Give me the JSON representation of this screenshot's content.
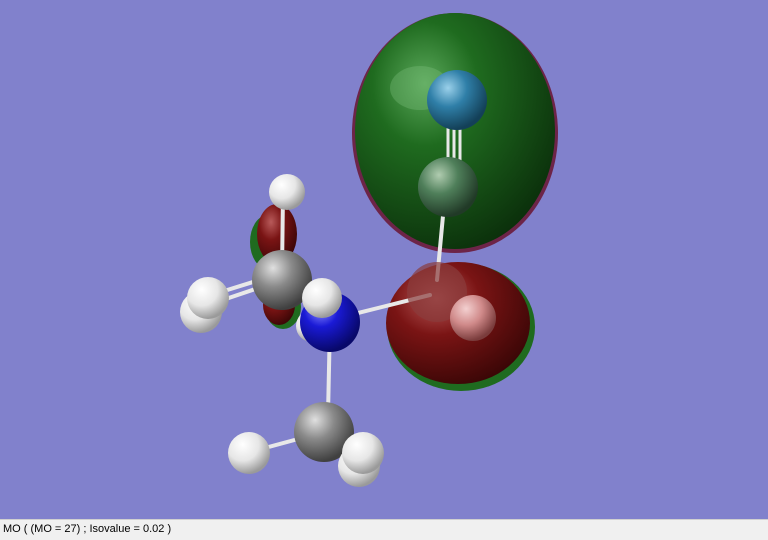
{
  "viewer": {
    "background_color": "#8181cc",
    "lobe_positive_color": "#1f6b1f",
    "lobe_negative_color": "#7a1414",
    "atom_colors": {
      "nitrogen": "#1a1ad6",
      "carbon": "#8a8a8a",
      "hydrogen": "#f2f2f2",
      "terminal_nitrogen": "#2f7fa8"
    },
    "bond_color": "#e8e8e8"
  },
  "status": {
    "text": "MO ( (MO = 27) ; Isovalue = 0.02 )"
  }
}
